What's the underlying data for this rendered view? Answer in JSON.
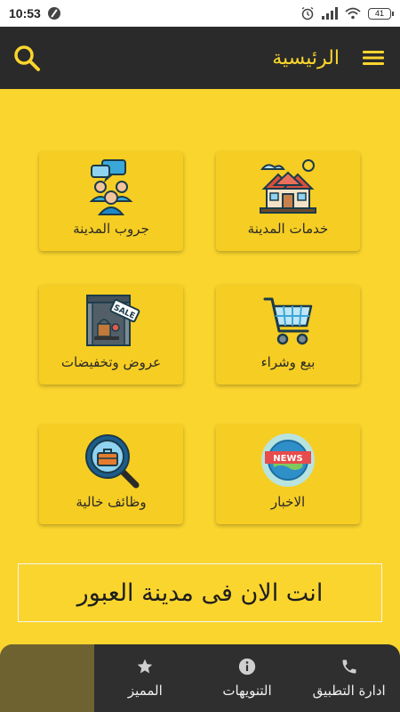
{
  "status_bar": {
    "time": "10:53",
    "battery": "41"
  },
  "app_bar": {
    "title": "الرئيسية"
  },
  "cards": [
    {
      "label": "جروب المدينة",
      "icon": "group-chat-icon"
    },
    {
      "label": "خدمات المدينة",
      "icon": "city-houses-icon"
    },
    {
      "label": "عروض وتخفيضات",
      "icon": "sale-shop-icon"
    },
    {
      "label": "بيع وشراء",
      "icon": "shopping-cart-icon"
    },
    {
      "label": "وظائف خالية",
      "icon": "job-search-icon"
    },
    {
      "label": "الاخبار",
      "icon": "news-globe-icon"
    }
  ],
  "news_badge": "NEWS",
  "sale_tag": "SALE",
  "location": {
    "text": "انت الان فى مدينة العبور"
  },
  "bottom_nav": {
    "items": [
      {
        "label": "",
        "icon": "empty"
      },
      {
        "label": "المميز",
        "icon": "star-icon"
      },
      {
        "label": "التنويهات",
        "icon": "info-icon"
      },
      {
        "label": "ادارة التطبيق",
        "icon": "phone-icon"
      }
    ]
  },
  "colors": {
    "background": "#fad52e",
    "card": "#f6cd22",
    "appbar": "#2a2a2a",
    "accent": "#fad52e",
    "nav": "#2f2f2f"
  }
}
